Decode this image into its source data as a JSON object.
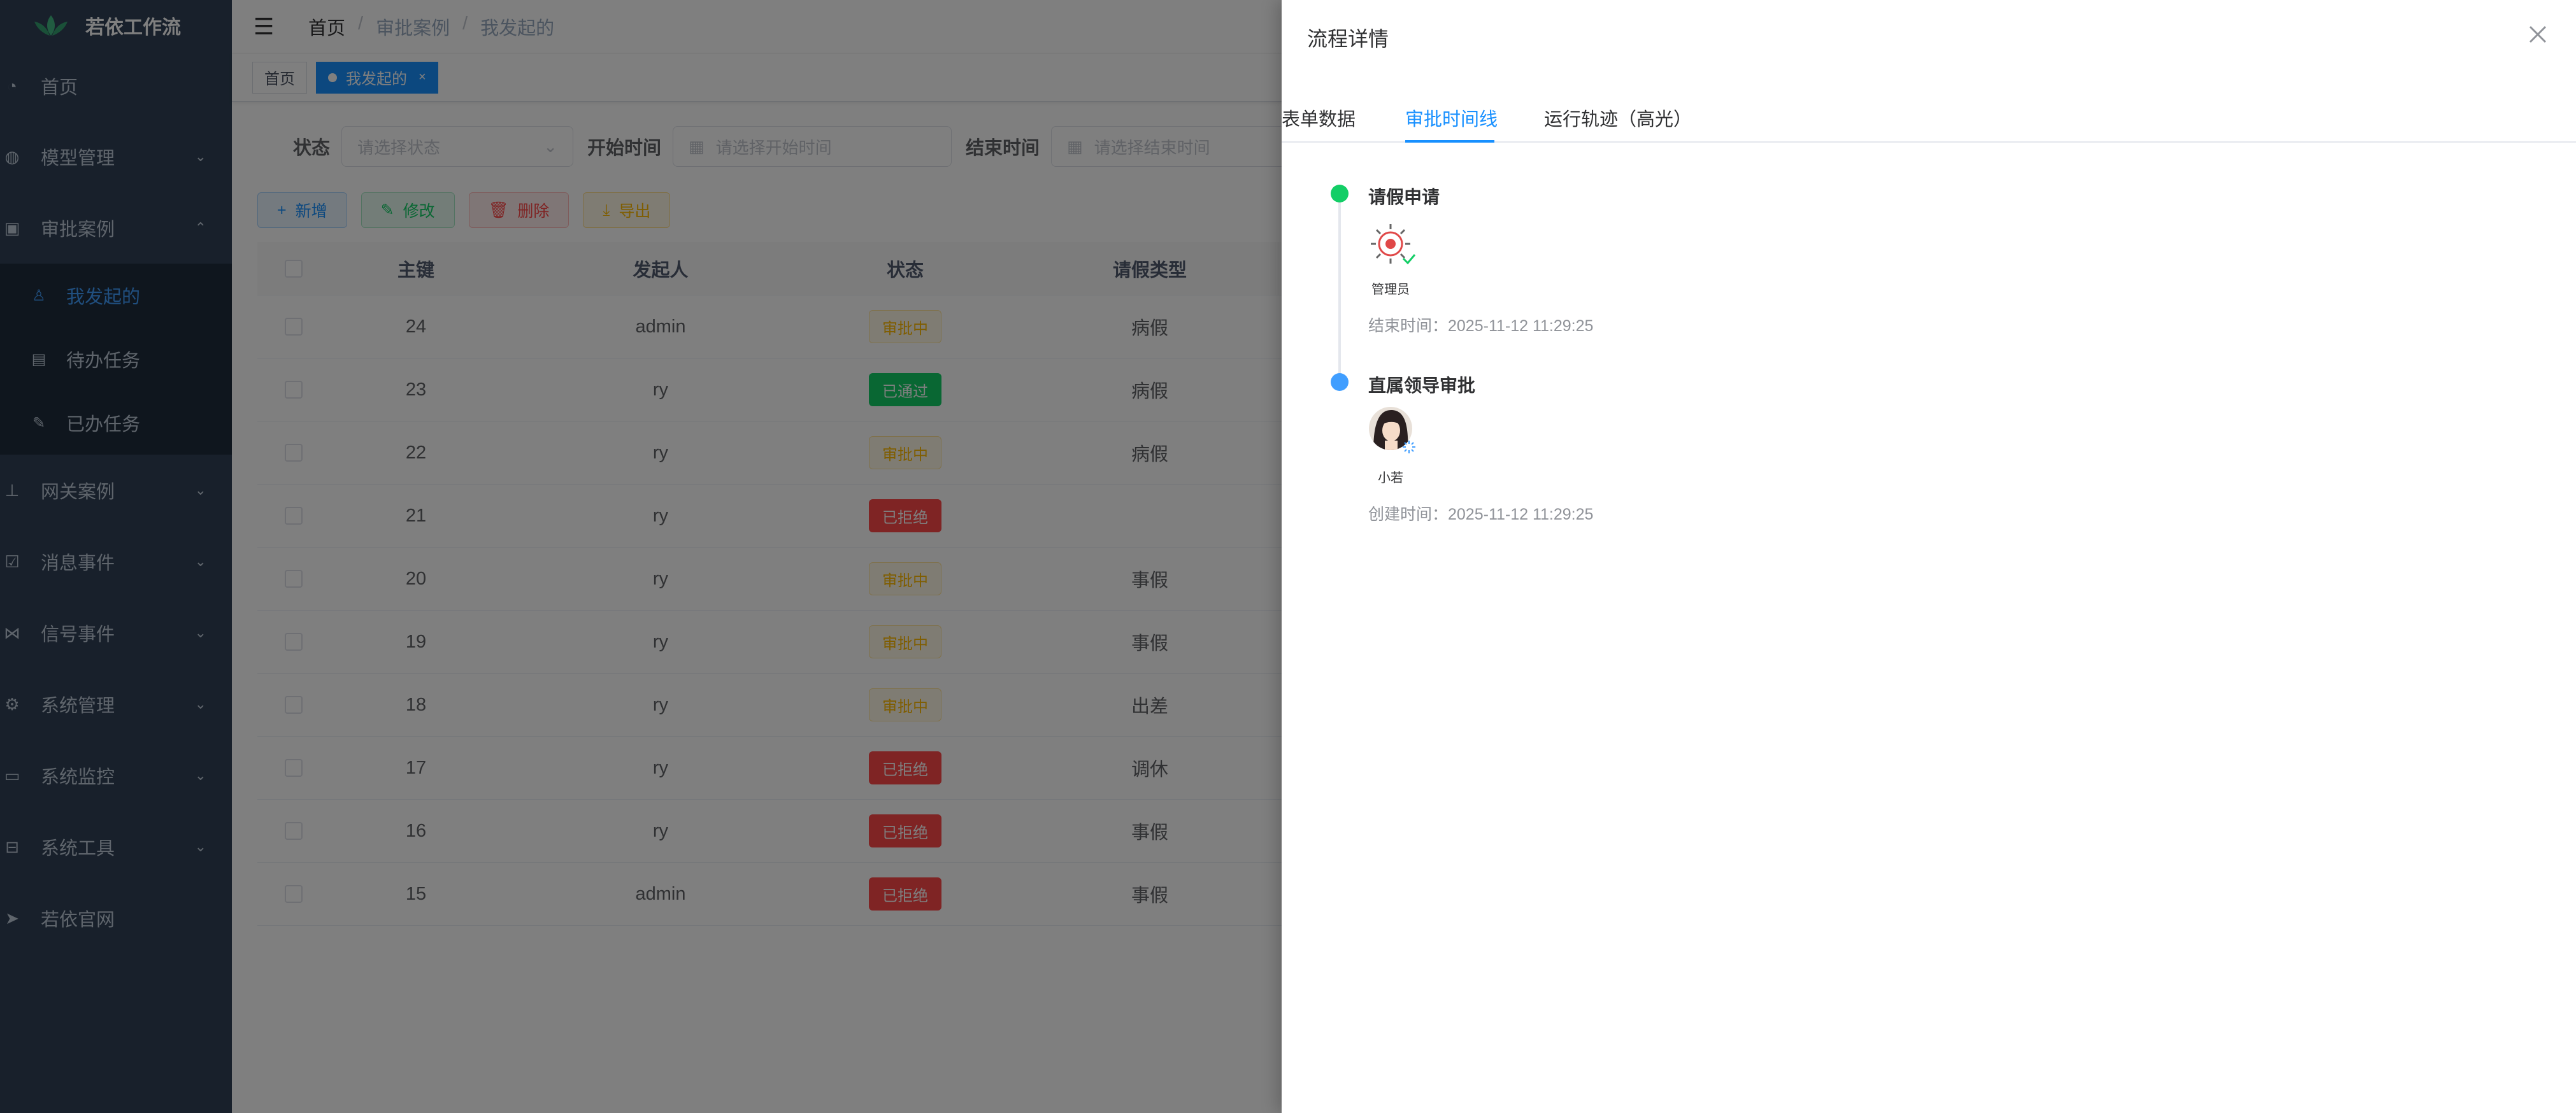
{
  "app": {
    "title": "若依工作流"
  },
  "sidebar": {
    "items": [
      {
        "label": "首页",
        "icon": "dashboard-icon"
      },
      {
        "label": "模型管理",
        "icon": "model-icon"
      },
      {
        "label": "审批案例",
        "icon": "approval-icon"
      },
      {
        "label": "网关案例",
        "icon": "tree-icon"
      },
      {
        "label": "消息事件",
        "icon": "checkbox-icon"
      },
      {
        "label": "信号事件",
        "icon": "signal-icon"
      },
      {
        "label": "系统管理",
        "icon": "gear-icon"
      },
      {
        "label": "系统监控",
        "icon": "monitor-icon"
      },
      {
        "label": "系统工具",
        "icon": "toolbox-icon"
      },
      {
        "label": "若依官网",
        "icon": "send-icon"
      }
    ],
    "submenu": [
      {
        "label": "我发起的",
        "icon": "user-icon"
      },
      {
        "label": "待办任务",
        "icon": "todo-icon"
      },
      {
        "label": "已办任务",
        "icon": "done-icon"
      }
    ]
  },
  "breadcrumb": {
    "home": "首页",
    "parent": "审批案例",
    "current": "我发起的"
  },
  "tags": {
    "home": "首页",
    "active": "我发起的"
  },
  "filters": {
    "status_label": "状态",
    "status_placeholder": "请选择状态",
    "start_label": "开始时间",
    "start_placeholder": "请选择开始时间",
    "end_label": "结束时间",
    "end_placeholder": "请选择结束时间"
  },
  "toolbar": {
    "add": "新增",
    "edit": "修改",
    "delete": "删除",
    "export": "导出"
  },
  "table": {
    "columns": [
      "主键",
      "发起人",
      "状态",
      "请假类型"
    ],
    "rows": [
      {
        "id": "24",
        "user": "admin",
        "status": "审批中",
        "status_kind": "warn",
        "type": "病假"
      },
      {
        "id": "23",
        "user": "ry",
        "status": "已通过",
        "status_kind": "ok",
        "type": "病假"
      },
      {
        "id": "22",
        "user": "ry",
        "status": "审批中",
        "status_kind": "warn",
        "type": "病假"
      },
      {
        "id": "21",
        "user": "ry",
        "status": "已拒绝",
        "status_kind": "bad",
        "type": ""
      },
      {
        "id": "20",
        "user": "ry",
        "status": "审批中",
        "status_kind": "warn",
        "type": "事假"
      },
      {
        "id": "19",
        "user": "ry",
        "status": "审批中",
        "status_kind": "warn",
        "type": "事假"
      },
      {
        "id": "18",
        "user": "ry",
        "status": "审批中",
        "status_kind": "warn",
        "type": "出差"
      },
      {
        "id": "17",
        "user": "ry",
        "status": "已拒绝",
        "status_kind": "bad",
        "type": "调休"
      },
      {
        "id": "16",
        "user": "ry",
        "status": "已拒绝",
        "status_kind": "bad",
        "type": "事假"
      },
      {
        "id": "15",
        "user": "admin",
        "status": "已拒绝",
        "status_kind": "bad",
        "type": "事假"
      }
    ]
  },
  "drawer": {
    "title": "流程详情",
    "tabs": [
      "表单数据",
      "审批时间线",
      "运行轨迹（高光）"
    ],
    "active_tab": 1,
    "timeline": [
      {
        "title": "请假申请",
        "user": "管理员",
        "time_label": "结束时间：2025-11-12 11:29:25",
        "node_color": "#13ce66",
        "state": "done"
      },
      {
        "title": "直属领导审批",
        "user": "小若",
        "time_label": "创建时间：2025-11-12 11:29:25",
        "node_color": "#409eff",
        "state": "pending"
      }
    ]
  },
  "colors": {
    "sidebar_bg": "#304156",
    "primary": "#1890ff",
    "success": "#13ce66",
    "danger": "#ff4949",
    "warning": "#ffba00"
  }
}
